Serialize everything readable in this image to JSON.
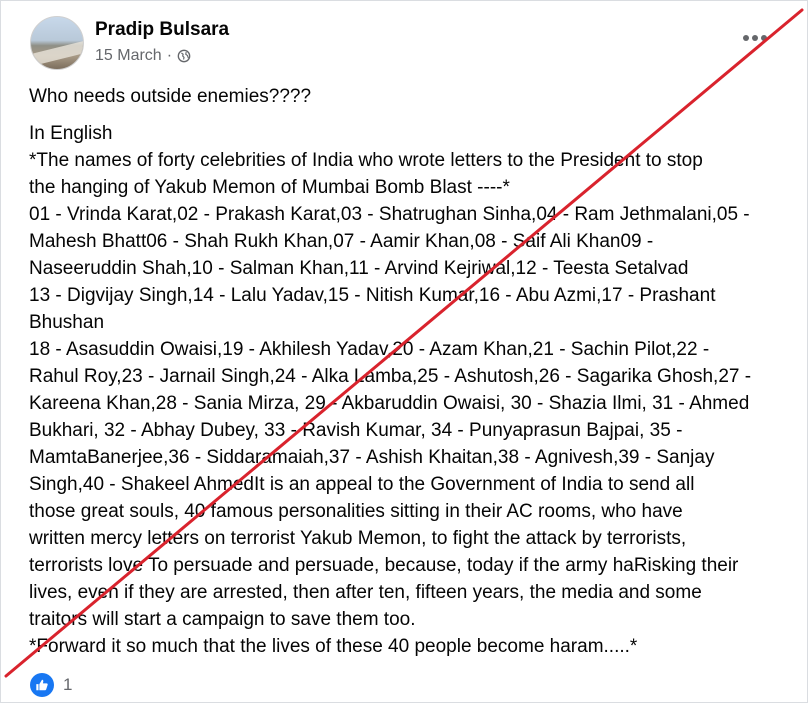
{
  "post": {
    "author": "Pradip Bulsara",
    "date": "15 March",
    "date_separator": "·",
    "icons": {
      "more": "more-options-icon",
      "audience": "globe-icon",
      "reaction": "like-icon"
    },
    "lines": [
      "Who needs outside enemies????",
      "In English",
      "*The names of forty celebrities of India who wrote letters to the President to stop",
      "the hanging of Yakub Memon of Mumbai Bomb Blast ----*",
      "01 - Vrinda Karat,02 - Prakash Karat,03 - Shatrughan Sinha,04 - Ram Jethmalani,05 -",
      "Mahesh Bhatt06 - Shah Rukh Khan,07 - Aamir Khan,08 - Saif Ali Khan09 -",
      "Naseeruddin Shah,10 - Salman Khan,11 - Arvind Kejriwal,12 - Teesta Setalvad",
      "13 - Digvijay Singh,14 - Lalu Yadav,15 - Nitish Kumar,16 - Abu Azmi,17 - Prashant",
      "Bhushan",
      "18 - Asasuddin Owaisi,19 - Akhilesh Yadav,20 - Azam Khan,21 - Sachin Pilot,22 -",
      "Rahul Roy,23 - Jarnail Singh,24 - Alka Lamba,25 - Ashutosh,26 - Sagarika Ghosh,27 -",
      "Kareena Khan,28 - Sania Mirza, 29 - Akbaruddin Owaisi, 30 - Shazia Ilmi, 31 - Ahmed",
      "Bukhari, 32 - Abhay Dubey, 33 - Ravish Kumar, 34 - Punyaprasun Bajpai, 35 -",
      "MamtaBanerjee,36 - Siddaramaiah,37 - Ashish Khaitan,38 - Agnivesh,39 - Sanjay",
      "Singh,40 - Shakeel AhmedIt is an appeal to the Government of India to send all",
      "those great souls, 40 famous personalities sitting in their AC rooms, who have",
      "written mercy letters on terrorist Yakub Memon, to fight the attack by terrorists,",
      "terrorists love To persuade and persuade, because, today if the army haRisking their",
      "lives, even if they are arrested, then after ten, fifteen years, the media and some",
      "traitors will start a campaign to save them too.",
      "*Forward it so much that the lives of these 40 people become haram.....*"
    ],
    "reaction_count": "1"
  },
  "colors": {
    "strike": "#d9232d",
    "like": "#1877f2",
    "muted": "#65676b"
  }
}
